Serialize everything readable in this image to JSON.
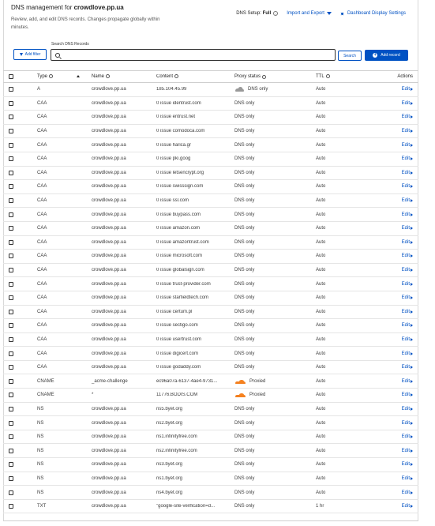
{
  "header": {
    "title_prefix": "DNS management for ",
    "domain": "crowdlove.pp.ua",
    "subtitle": "Review, add, and edit DNS records. Changes propagate globally within minutes.",
    "dns_setup_label": "DNS Setup:",
    "dns_setup_value": "Full",
    "import_export": "Import and Export",
    "dashboard_settings": "Dashboard Display Settings"
  },
  "toolbar": {
    "search_label": "Search DNS Records",
    "search_placeholder": "",
    "add_filter": "Add filter",
    "search_button": "Search",
    "add_record": "Add record"
  },
  "table": {
    "columns": {
      "type": "Type",
      "name": "Name",
      "content": "Content",
      "proxy": "Proxy status",
      "ttl": "TTL",
      "actions": "Actions"
    },
    "edit_label": "Edit",
    "rows": [
      {
        "type": "A",
        "name": "crowdlove.pp.ua",
        "content": "185.104.45.99",
        "proxy": "DNS only",
        "proxy_icon": "grey-cloud-icon",
        "ttl": "Auto"
      },
      {
        "type": "CAA",
        "name": "crowdlove.pp.ua",
        "content": "0 issue identrust.com",
        "proxy": "DNS only",
        "proxy_icon": "",
        "ttl": "Auto"
      },
      {
        "type": "CAA",
        "name": "crowdlove.pp.ua",
        "content": "0 issue entrust.net",
        "proxy": "DNS only",
        "proxy_icon": "",
        "ttl": "Auto"
      },
      {
        "type": "CAA",
        "name": "crowdlove.pp.ua",
        "content": "0 issue comodoca.com",
        "proxy": "DNS only",
        "proxy_icon": "",
        "ttl": "Auto"
      },
      {
        "type": "CAA",
        "name": "crowdlove.pp.ua",
        "content": "0 issue harica.gr",
        "proxy": "DNS only",
        "proxy_icon": "",
        "ttl": "Auto"
      },
      {
        "type": "CAA",
        "name": "crowdlove.pp.ua",
        "content": "0 issue pki.goog",
        "proxy": "DNS only",
        "proxy_icon": "",
        "ttl": "Auto"
      },
      {
        "type": "CAA",
        "name": "crowdlove.pp.ua",
        "content": "0 issue letsencrypt.org",
        "proxy": "DNS only",
        "proxy_icon": "",
        "ttl": "Auto"
      },
      {
        "type": "CAA",
        "name": "crowdlove.pp.ua",
        "content": "0 issue swisssign.com",
        "proxy": "DNS only",
        "proxy_icon": "",
        "ttl": "Auto"
      },
      {
        "type": "CAA",
        "name": "crowdlove.pp.ua",
        "content": "0 issue ssl.com",
        "proxy": "DNS only",
        "proxy_icon": "",
        "ttl": "Auto"
      },
      {
        "type": "CAA",
        "name": "crowdlove.pp.ua",
        "content": "0 issue buypass.com",
        "proxy": "DNS only",
        "proxy_icon": "",
        "ttl": "Auto"
      },
      {
        "type": "CAA",
        "name": "crowdlove.pp.ua",
        "content": "0 issue amazon.com",
        "proxy": "DNS only",
        "proxy_icon": "",
        "ttl": "Auto"
      },
      {
        "type": "CAA",
        "name": "crowdlove.pp.ua",
        "content": "0 issue amazontrust.com",
        "proxy": "DNS only",
        "proxy_icon": "",
        "ttl": "Auto"
      },
      {
        "type": "CAA",
        "name": "crowdlove.pp.ua",
        "content": "0 issue microsoft.com",
        "proxy": "DNS only",
        "proxy_icon": "",
        "ttl": "Auto"
      },
      {
        "type": "CAA",
        "name": "crowdlove.pp.ua",
        "content": "0 issue globalsign.com",
        "proxy": "DNS only",
        "proxy_icon": "",
        "ttl": "Auto"
      },
      {
        "type": "CAA",
        "name": "crowdlove.pp.ua",
        "content": "0 issue trust-provider.com",
        "proxy": "DNS only",
        "proxy_icon": "",
        "ttl": "Auto"
      },
      {
        "type": "CAA",
        "name": "crowdlove.pp.ua",
        "content": "0 issue starfieldtech.com",
        "proxy": "DNS only",
        "proxy_icon": "",
        "ttl": "Auto"
      },
      {
        "type": "CAA",
        "name": "crowdlove.pp.ua",
        "content": "0 issue certum.pl",
        "proxy": "DNS only",
        "proxy_icon": "",
        "ttl": "Auto"
      },
      {
        "type": "CAA",
        "name": "crowdlove.pp.ua",
        "content": "0 issue sectigo.com",
        "proxy": "DNS only",
        "proxy_icon": "",
        "ttl": "Auto"
      },
      {
        "type": "CAA",
        "name": "crowdlove.pp.ua",
        "content": "0 issue usertrust.com",
        "proxy": "DNS only",
        "proxy_icon": "",
        "ttl": "Auto"
      },
      {
        "type": "CAA",
        "name": "crowdlove.pp.ua",
        "content": "0 issue digicert.com",
        "proxy": "DNS only",
        "proxy_icon": "",
        "ttl": "Auto"
      },
      {
        "type": "CAA",
        "name": "crowdlove.pp.ua",
        "content": "0 issue godaddy.com",
        "proxy": "DNS only",
        "proxy_icon": "",
        "ttl": "Auto"
      },
      {
        "type": "CNAME",
        "name": "_acme-challenge",
        "content": "ec96a07a-6137-4ae4-9731...",
        "proxy": "Proxied",
        "proxy_icon": "orange-cloud-icon",
        "ttl": "Auto"
      },
      {
        "type": "CNAME",
        "name": "*",
        "content": "11776.BODIS.COM",
        "proxy": "Proxied",
        "proxy_icon": "orange-cloud-icon",
        "ttl": "Auto"
      },
      {
        "type": "NS",
        "name": "crowdlove.pp.ua",
        "content": "ns5.byet.org",
        "proxy": "DNS only",
        "proxy_icon": "",
        "ttl": "Auto"
      },
      {
        "type": "NS",
        "name": "crowdlove.pp.ua",
        "content": "ns2.byet.org",
        "proxy": "DNS only",
        "proxy_icon": "",
        "ttl": "Auto"
      },
      {
        "type": "NS",
        "name": "crowdlove.pp.ua",
        "content": "ns1.infinityfree.com",
        "proxy": "DNS only",
        "proxy_icon": "",
        "ttl": "Auto"
      },
      {
        "type": "NS",
        "name": "crowdlove.pp.ua",
        "content": "ns2.infinityfree.com",
        "proxy": "DNS only",
        "proxy_icon": "",
        "ttl": "Auto"
      },
      {
        "type": "NS",
        "name": "crowdlove.pp.ua",
        "content": "ns3.byet.org",
        "proxy": "DNS only",
        "proxy_icon": "",
        "ttl": "Auto"
      },
      {
        "type": "NS",
        "name": "crowdlove.pp.ua",
        "content": "ns1.byet.org",
        "proxy": "DNS only",
        "proxy_icon": "",
        "ttl": "Auto"
      },
      {
        "type": "NS",
        "name": "crowdlove.pp.ua",
        "content": "ns4.byet.org",
        "proxy": "DNS only",
        "proxy_icon": "",
        "ttl": "Auto"
      },
      {
        "type": "TXT",
        "name": "crowdlove.pp.ua",
        "content": "\"google-site-verification=d...",
        "proxy": "DNS only",
        "proxy_icon": "",
        "ttl": "1 hr"
      }
    ]
  },
  "colors": {
    "accent": "#0051c3",
    "proxied": "#f38020",
    "dns_only": "#999999"
  }
}
